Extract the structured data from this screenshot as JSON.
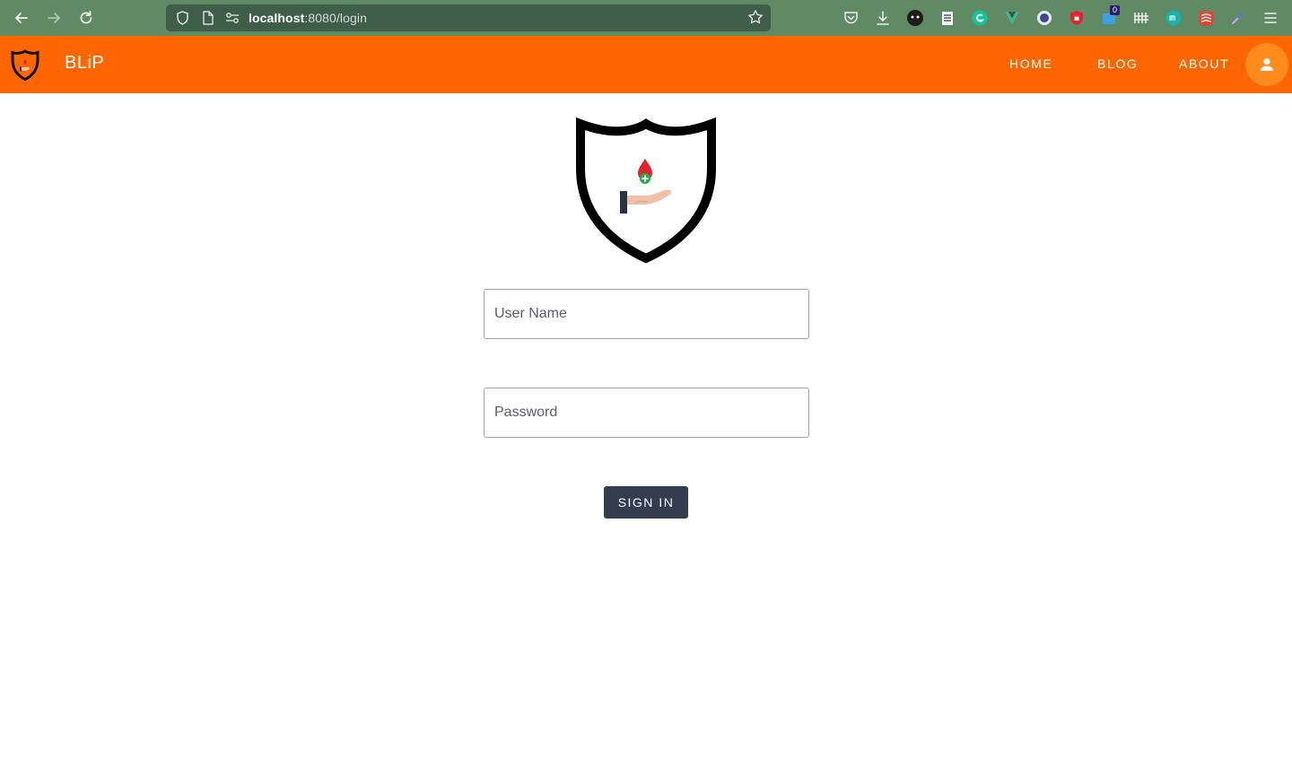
{
  "browser": {
    "url_host": "localhost",
    "url_rest": ":8080/login",
    "extension_badge": "0"
  },
  "header": {
    "brand": "BLiP",
    "nav": {
      "home": "HOME",
      "blog": "BLOG",
      "about": "ABOUT"
    },
    "accent_color": "#ff6600"
  },
  "login": {
    "username_placeholder": "User Name",
    "password_placeholder": "Password",
    "signin_label": "SIGN IN"
  }
}
